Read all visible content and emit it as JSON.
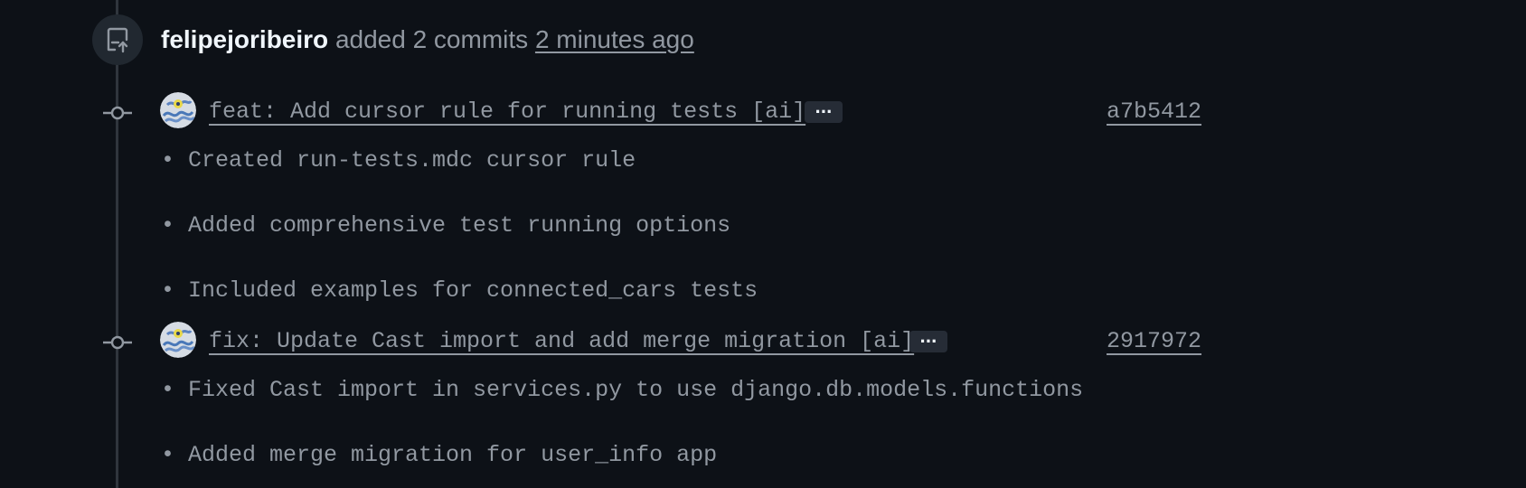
{
  "event": {
    "author": "felipejoribeiro",
    "action": "added 2 commits",
    "time": "2 minutes ago",
    "icon": "repo-push-icon"
  },
  "commits": [
    {
      "message": "feat: Add cursor rule for running tests [ai]",
      "more_label": "···",
      "sha": "a7b5412",
      "bullets": [
        "• Created run-tests.mdc cursor rule",
        "• Added comprehensive test running options",
        "• Included examples for connected_cars tests"
      ]
    },
    {
      "message": "fix: Update Cast import and add merge migration [ai]",
      "more_label": "···",
      "sha": "2917972",
      "bullets": [
        "• Fixed Cast import in services.py to use django.db.models.functions",
        "• Added merge migration for user_info app"
      ]
    }
  ],
  "colors": {
    "background": "#0d1117",
    "text_primary": "#f0f6fc",
    "text_muted": "#9198a1",
    "timeline": "#30363d"
  }
}
